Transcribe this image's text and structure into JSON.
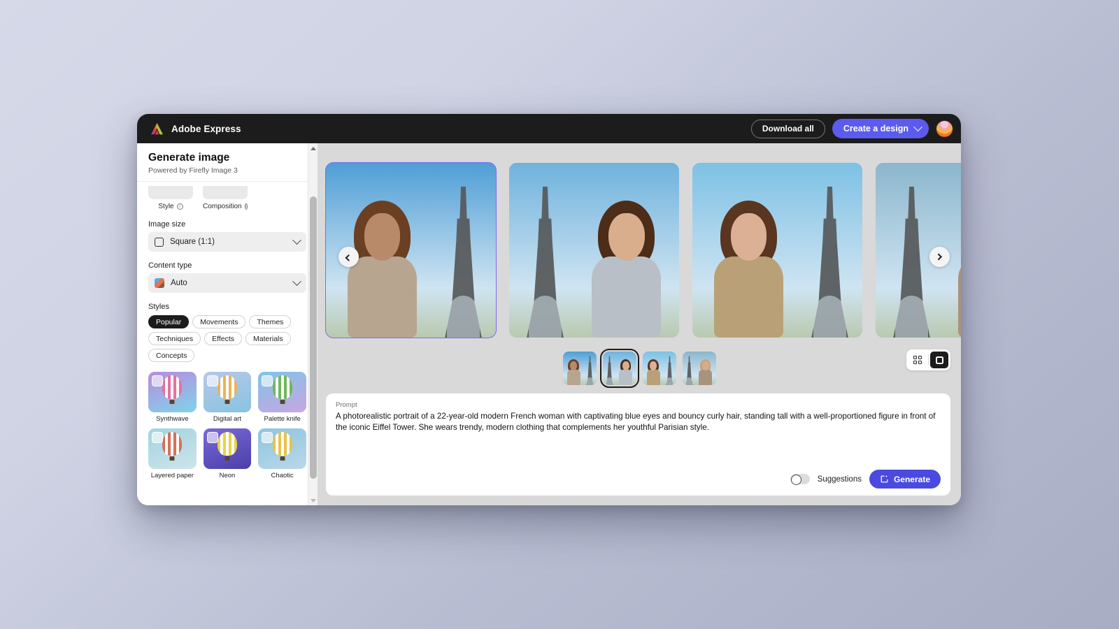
{
  "header": {
    "brand": "Adobe Express",
    "download_all_label": "Download all",
    "create_design_label": "Create a design"
  },
  "sidebar": {
    "title": "Generate image",
    "subtitle": "Powered by Firefly Image 3",
    "cut_controls": [
      {
        "label": "Style"
      },
      {
        "label": "Composition"
      }
    ],
    "image_size": {
      "label": "Image size",
      "value": "Square (1:1)"
    },
    "content_type": {
      "label": "Content type",
      "value": "Auto"
    },
    "styles": {
      "label": "Styles",
      "categories": [
        {
          "label": "Popular",
          "active": true
        },
        {
          "label": "Movements",
          "active": false
        },
        {
          "label": "Themes",
          "active": false
        },
        {
          "label": "Techniques",
          "active": false
        },
        {
          "label": "Effects",
          "active": false
        },
        {
          "label": "Materials",
          "active": false
        },
        {
          "label": "Concepts",
          "active": false
        }
      ],
      "items": [
        {
          "name": "Synthwave",
          "c1": "#b98ae0",
          "c2": "#7fd4e8",
          "bc": "#e86fa0"
        },
        {
          "name": "Digital art",
          "c1": "#b9c7e8",
          "c2": "#86c4e0",
          "bc": "#e8b45a"
        },
        {
          "name": "Palette knife",
          "c1": "#7ec4e8",
          "c2": "#c9a6e0",
          "bc": "#6fb85a"
        },
        {
          "name": "Layered paper",
          "c1": "#9fd4e0",
          "c2": "#cfe4ea",
          "bc": "#d4705a"
        },
        {
          "name": "Neon",
          "c1": "#7a6ad8",
          "c2": "#4a3fa8",
          "bc": "#e8d24a"
        },
        {
          "name": "Chaotic",
          "c1": "#8fc4e0",
          "c2": "#b9d8e8",
          "bc": "#e8c24a"
        }
      ]
    }
  },
  "main": {
    "results": [
      {
        "alt": "Curly haired woman in beige wrap top before Eiffel Tower",
        "selected": true,
        "sky": "#4f9ed6",
        "skin": "#b98a6a",
        "hair": "#6b3f22",
        "outfit": "#b8a58f"
      },
      {
        "alt": "Close-up portrait of woman with grey jacket at Eiffel Tower",
        "selected": false,
        "sky": "#6fb2dd",
        "skin": "#d9ae8c",
        "hair": "#4d2d18",
        "outfit": "#b9bfc7"
      },
      {
        "alt": "Woman in checked blazer beside Eiffel Tower",
        "selected": false,
        "sky": "#7dc1e4",
        "skin": "#dcb094",
        "hair": "#5a3520",
        "outfit": "#b9a077"
      },
      {
        "alt": "Woman in tan coat in front of Eiffel Tower",
        "selected": false,
        "sky": "#8bb6cc",
        "skin": "#d7ab8d",
        "hair": "#c9a474",
        "outfit": "#a8937c"
      }
    ],
    "thumbnails": [
      {
        "alt": "Thumbnail 1",
        "selected": false,
        "sky": "#4f9ed6",
        "skin": "#b98a6a",
        "hair": "#6b3f22",
        "outfit": "#b8a58f"
      },
      {
        "alt": "Thumbnail 2",
        "selected": true,
        "sky": "#6fb2dd",
        "skin": "#d9ae8c",
        "hair": "#4d2d18",
        "outfit": "#b9bfc7"
      },
      {
        "alt": "Thumbnail 3",
        "selected": false,
        "sky": "#7dc1e4",
        "skin": "#dcb094",
        "hair": "#5a3520",
        "outfit": "#b9a077"
      },
      {
        "alt": "Thumbnail 4",
        "selected": false,
        "sky": "#8bb6cc",
        "skin": "#d7ab8d",
        "hair": "#c9a474",
        "outfit": "#a8937c"
      }
    ],
    "view_modes": [
      {
        "name": "grid-view",
        "selected": false
      },
      {
        "name": "single-view",
        "selected": true
      }
    ],
    "prompt": {
      "label": "Prompt",
      "value": "A photorealistic portrait of a 22-year-old modern French woman with captivating blue eyes and bouncy curly hair, standing tall with a well-proportioned figure in front of the iconic Eiffel Tower. She wears trendy, modern clothing that complements her youthful Parisian style.",
      "suggestions_label": "Suggestions",
      "suggestions_on": false,
      "generate_label": "Generate"
    }
  },
  "colors": {
    "accent": "#5b5bef",
    "generate": "#4a4ae0",
    "selection": "#7b6cf0",
    "header_bg": "#1c1c1c",
    "canvas_bg": "#d9d9d9"
  }
}
